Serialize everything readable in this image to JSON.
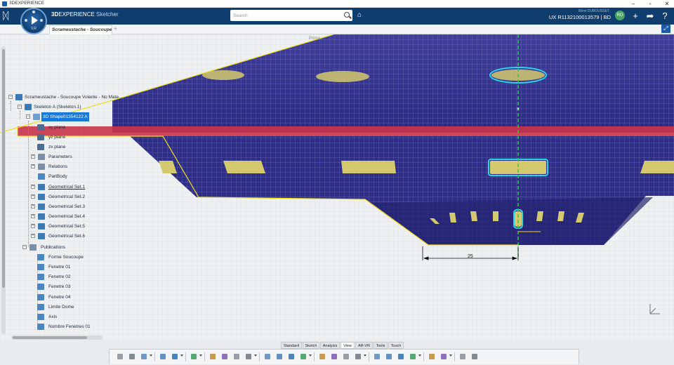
{
  "window": {
    "title": "3DEXPERIENCE",
    "controls": [
      "minimize",
      "maximize",
      "close"
    ]
  },
  "header": {
    "brand_3d": "3D",
    "brand_experience": "EXPERIENCE",
    "app_name": "Sketcher",
    "search_placeholder": "Search",
    "user_name": "Rémi DUBOUSSET",
    "context": "UX R1132100013579 | BD",
    "avatar_initials": "RD",
    "compass_label": "V,R",
    "colors": {
      "header_bg": "#0f3d6e",
      "accent": "#1979d9"
    }
  },
  "tab": {
    "title": "Scrameustache - Soucoupe Vo..."
  },
  "viewport": {
    "priority_label": "Prima...",
    "dimension_value": "25"
  },
  "tree": {
    "root": "Scrameustache - Soucoupe Volante - No Mate...",
    "skeleton": "Skeleton A (Skeleton.1)",
    "shape": "3D Shape01354122 A",
    "planes": [
      "xy plane",
      "yz plane",
      "zx plane"
    ],
    "items": [
      {
        "label": "Parameters",
        "underline": false
      },
      {
        "label": "Relations",
        "underline": false
      },
      {
        "label": "PartBody",
        "underline": false
      },
      {
        "label": "Geometrical Set.1",
        "underline": true
      },
      {
        "label": "Geometrical Set.2",
        "underline": false
      },
      {
        "label": "Geometrical Set.3",
        "underline": false
      },
      {
        "label": "Geometrical Set.4",
        "underline": false
      },
      {
        "label": "Geometrical Set.5",
        "underline": false
      },
      {
        "label": "Geometrical Set.6",
        "underline": false
      }
    ],
    "publications_label": "Publications",
    "publications": [
      "Forme Soucoupe",
      "Fenetre 01",
      "Fenetre 02",
      "Fenetre 03",
      "Fenetre 04",
      "Limite Dome",
      "Axis",
      "Nombre Fenetres 01"
    ]
  },
  "actionbar": {
    "sections": [
      {
        "label": "Standard",
        "active": false
      },
      {
        "label": "Sketch",
        "active": false
      },
      {
        "label": "Analysis",
        "active": false
      },
      {
        "label": "View",
        "active": true
      },
      {
        "label": "AR-VR",
        "active": false
      },
      {
        "label": "Tools",
        "active": false
      },
      {
        "label": "Touch",
        "active": false
      }
    ],
    "tools": [
      "cut-icon",
      "copy-icon",
      "paste-icon",
      "undo-icon",
      "fly-mode-icon",
      "share-icon",
      "zoom-icon",
      "pan-icon",
      "rotate-icon",
      "zoom-area-icon",
      "capture-icon",
      "render-style-icon",
      "view-cube-icon",
      "material-icon",
      "shading-icon",
      "color-icon",
      "filter-icon",
      "grid-icon",
      "constraint-icon",
      "dimension-icon",
      "hide-icon",
      "snap-icon",
      "measure-icon",
      "clipboard-icon",
      "settings-icon",
      "tools-icon"
    ]
  }
}
